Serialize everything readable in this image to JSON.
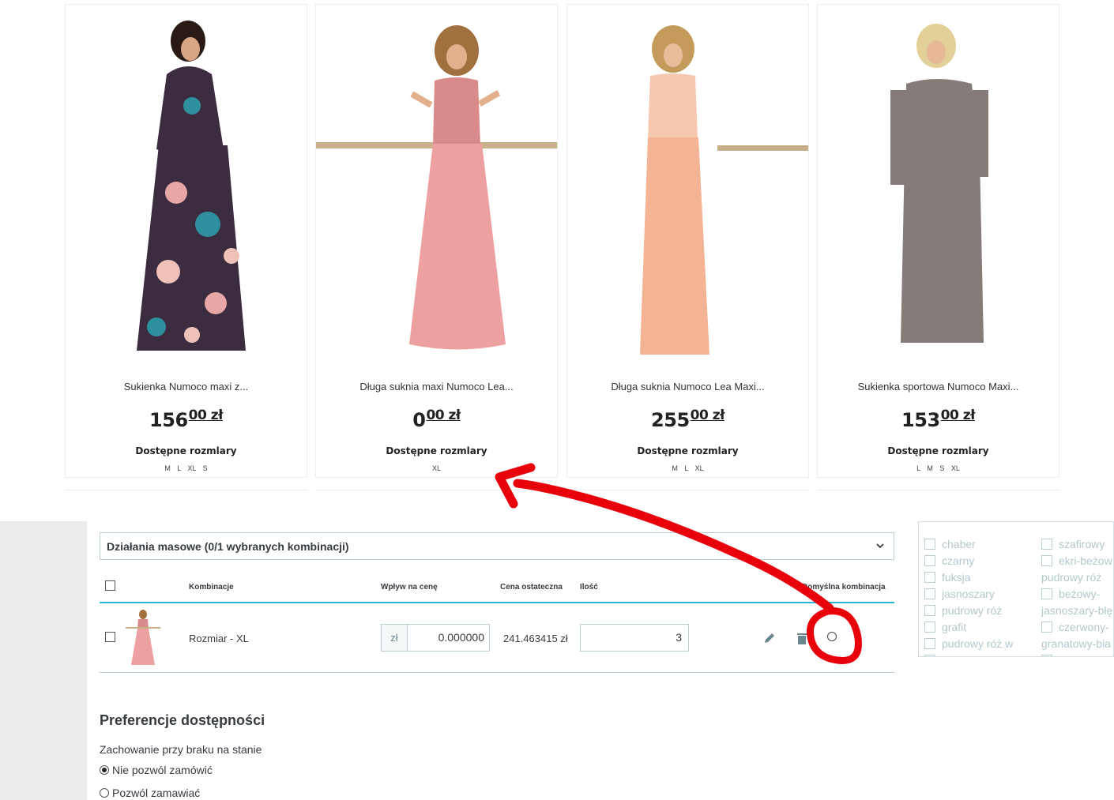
{
  "products": [
    {
      "name": "Sukienka Numoco maxi z...",
      "price_main": "156",
      "price_cents": "00 zł",
      "avail_label": "Dostępne rozmlary",
      "sizes": "M L XL S",
      "color": "#3b2d3f",
      "image_alt": "floral-dress-photo"
    },
    {
      "name": "Długa suknia maxi Numoco Lea...",
      "price_main": "0",
      "price_cents": "00 zł",
      "avail_label": "Dostępne rozmlary",
      "sizes": "XL",
      "color": "#eda0a0",
      "image_alt": "pink-dress-photo"
    },
    {
      "name": "Długa suknia Numoco Lea Maxi...",
      "price_main": "255",
      "price_cents": "00 zł",
      "avail_label": "Dostępne rozmlary",
      "sizes": "M L XL",
      "color": "#f3b394",
      "image_alt": "peach-dress-photo"
    },
    {
      "name": "Sukienka sportowa Numoco Maxi...",
      "price_main": "153",
      "price_cents": "00 zł",
      "avail_label": "Dostępne rozmlary",
      "sizes": "L M S XL",
      "color": "#857b79",
      "image_alt": "gray-dress-photo"
    }
  ],
  "mass_actions": {
    "label": "Działania masowe (0/1 wybranych kombinacji)",
    "icon": "chevron-down-icon"
  },
  "table": {
    "headers": {
      "combinations": "Kombinacje",
      "price_impact": "Wpływ na cenę",
      "final_price": "Cena ostateczna",
      "quantity": "Ilość",
      "default": "Domyślna kombinacja"
    },
    "rows": [
      {
        "name": "Rozmiar - XL",
        "currency": "zł",
        "impact": "0.000000",
        "final": "241.463415 zł",
        "qty": "3"
      }
    ]
  },
  "colors_filter": {
    "left": [
      "chaber",
      "czarny",
      "fuksja",
      "jasnoszary",
      "pudrowy róż",
      "grafit",
      "pudrowy róż w"
    ],
    "right": [
      "szafirowy",
      "ekri-beżow",
      "pudrowy róż",
      "beżowy-",
      "jasnoszary-błę",
      "czerwony-",
      "granatowy-bia"
    ]
  },
  "availability": {
    "title": "Preferencje dostępności",
    "behaviour_label": "Zachowanie przy braku na stanie",
    "options": [
      "Nie pozwól zamówić",
      "Pozwól zamawiać"
    ]
  },
  "colors": {
    "accent": "#25b9d7",
    "annotation": "#e8000b",
    "border": "#bbcdd2"
  }
}
